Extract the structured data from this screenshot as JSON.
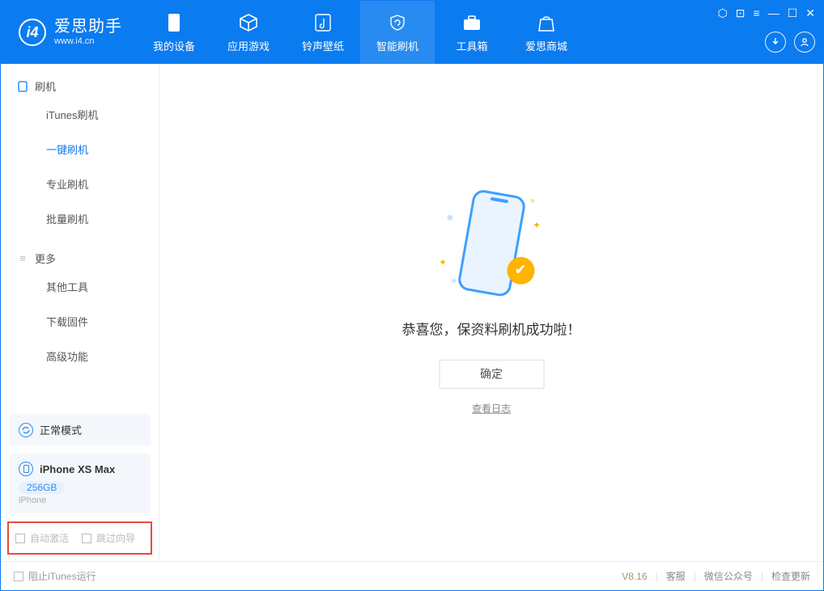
{
  "header": {
    "brand_title": "爱思助手",
    "brand_sub": "www.i4.cn",
    "tabs": [
      {
        "label": "我的设备"
      },
      {
        "label": "应用游戏"
      },
      {
        "label": "铃声壁纸"
      },
      {
        "label": "智能刷机"
      },
      {
        "label": "工具箱"
      },
      {
        "label": "爱思商城"
      }
    ]
  },
  "sidebar": {
    "section1": {
      "title": "刷机",
      "items": [
        {
          "label": "iTunes刷机"
        },
        {
          "label": "一键刷机"
        },
        {
          "label": "专业刷机"
        },
        {
          "label": "批量刷机"
        }
      ]
    },
    "section2": {
      "title": "更多",
      "items": [
        {
          "label": "其他工具"
        },
        {
          "label": "下载固件"
        },
        {
          "label": "高级功能"
        }
      ]
    },
    "mode_normal": "正常模式",
    "device": {
      "name": "iPhone XS Max",
      "storage": "256GB",
      "type": "iPhone"
    },
    "checkbox_auto": "自动激活",
    "checkbox_skip": "跳过向导"
  },
  "main": {
    "message": "恭喜您，保资料刷机成功啦！",
    "ok": "确定",
    "log_link": "查看日志"
  },
  "footer": {
    "block_itunes": "阻止iTunes运行",
    "version": "V8.16",
    "support": "客服",
    "wechat": "微信公众号",
    "update": "检查更新"
  }
}
